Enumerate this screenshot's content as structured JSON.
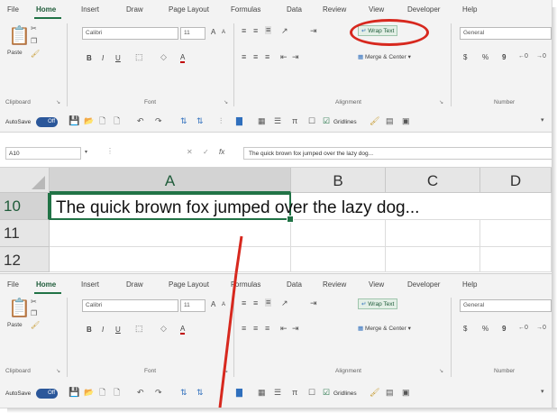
{
  "ribbon": {
    "tabs": [
      "File",
      "Home",
      "Insert",
      "Draw",
      "Page Layout",
      "Formulas",
      "Data",
      "Review",
      "View",
      "Developer",
      "Help"
    ],
    "active_tab": "Home",
    "clipboard": {
      "paste_label": "Paste",
      "group_label": "Clipboard"
    },
    "font": {
      "font_name": "Calibri",
      "font_size": "11",
      "grow": "A",
      "shrink": "A",
      "bold": "B",
      "italic": "I",
      "underline": "U",
      "font_color": "A",
      "group_label": "Font"
    },
    "alignment": {
      "wrap_text": "Wrap Text",
      "merge_center": "Merge & Center",
      "group_label": "Alignment"
    },
    "number": {
      "format": "General",
      "currency": "$",
      "percent": "%",
      "comma": "9",
      "group_label": "Number"
    }
  },
  "ribbon2": {
    "font_name": "Calibri",
    "number_format": "General",
    "wrap_text": "Wrap Text",
    "merge_center": "Merge & Center"
  },
  "qat": {
    "autosave_label": "AutoSave",
    "autosave_state": "Off",
    "gridlines_label": "Gridlines"
  },
  "formula_bar": {
    "name_box": "A10",
    "fx": "fx",
    "content": "The quick brown fox jumped over the lazy dog..."
  },
  "grid": {
    "columns": [
      "A",
      "B",
      "C",
      "D"
    ],
    "rows": [
      "10",
      "11",
      "12"
    ],
    "cell_text": "The quick brown fox jumped over the lazy dog..."
  },
  "colors": {
    "accent": "#217346",
    "annotation": "#d7281e"
  }
}
